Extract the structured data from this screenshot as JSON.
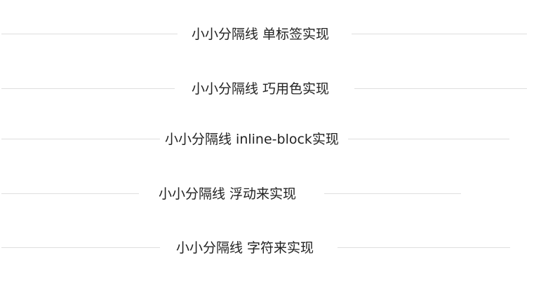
{
  "dividers": [
    {
      "text": "小小分隔线 单标签实现"
    },
    {
      "text": "小小分隔线 巧用色实现"
    },
    {
      "text": "小小分隔线 inline-block实现"
    },
    {
      "text": "小小分隔线 浮动来实现"
    },
    {
      "text": "小小分隔线 字符来实现"
    }
  ],
  "colors": {
    "line": "#dedede",
    "text": "#222222",
    "background": "#ffffff"
  }
}
